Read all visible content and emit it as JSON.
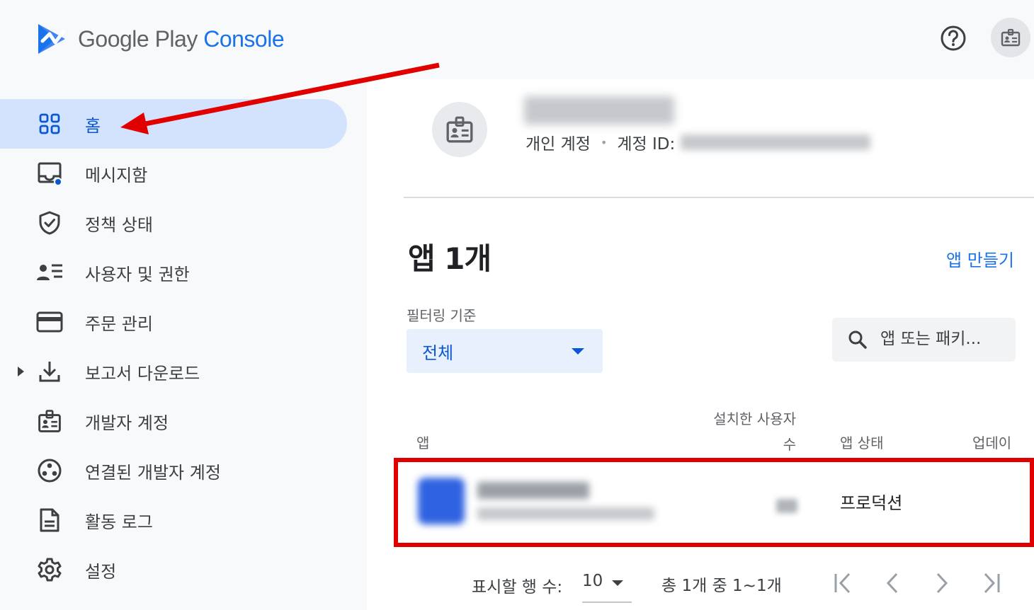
{
  "header": {
    "logo_word_google_play": "Google Play",
    "logo_word_console": "Console",
    "help_icon": "help-circle-icon",
    "account_icon": "badge-icon"
  },
  "sidebar": {
    "items": [
      {
        "label": "홈",
        "icon": "dashboard-grid-icon",
        "active": true
      },
      {
        "label": "메시지함",
        "icon": "inbox-icon",
        "badge": true
      },
      {
        "label": "정책 상태",
        "icon": "shield-check-icon"
      },
      {
        "label": "사용자 및 권한",
        "icon": "people-list-icon"
      },
      {
        "label": "주문 관리",
        "icon": "credit-card-icon"
      },
      {
        "label": "보고서 다운로드",
        "icon": "download-icon",
        "expandable": true
      },
      {
        "label": "개발자 계정",
        "icon": "badge-icon"
      },
      {
        "label": "연결된 개발자 계정",
        "icon": "linked-accounts-icon"
      },
      {
        "label": "활동 로그",
        "icon": "document-icon"
      },
      {
        "label": "설정",
        "icon": "gear-icon"
      }
    ]
  },
  "account": {
    "type_label": "개인 계정",
    "separator": "•",
    "id_label": "계정 ID:"
  },
  "apps_section": {
    "title": "앱 1개",
    "create_link": "앱 만들기",
    "filter_label": "필터링 기준",
    "filter_value": "전체",
    "search_placeholder": "앱 또는 패키..."
  },
  "table": {
    "columns": {
      "app": "앱",
      "installs": "설치한 사용자 수",
      "status": "앱 상태",
      "update": "업데이"
    },
    "rows": [
      {
        "status": "프로덕션"
      }
    ]
  },
  "pagination": {
    "rows_label": "표시할 행 수:",
    "rows_value": "10",
    "range": "총 1개 중 1~1개"
  },
  "colors": {
    "accent": "#1a73e8",
    "active_nav_bg": "#d3e3fd",
    "annotation_red": "#e00000"
  }
}
